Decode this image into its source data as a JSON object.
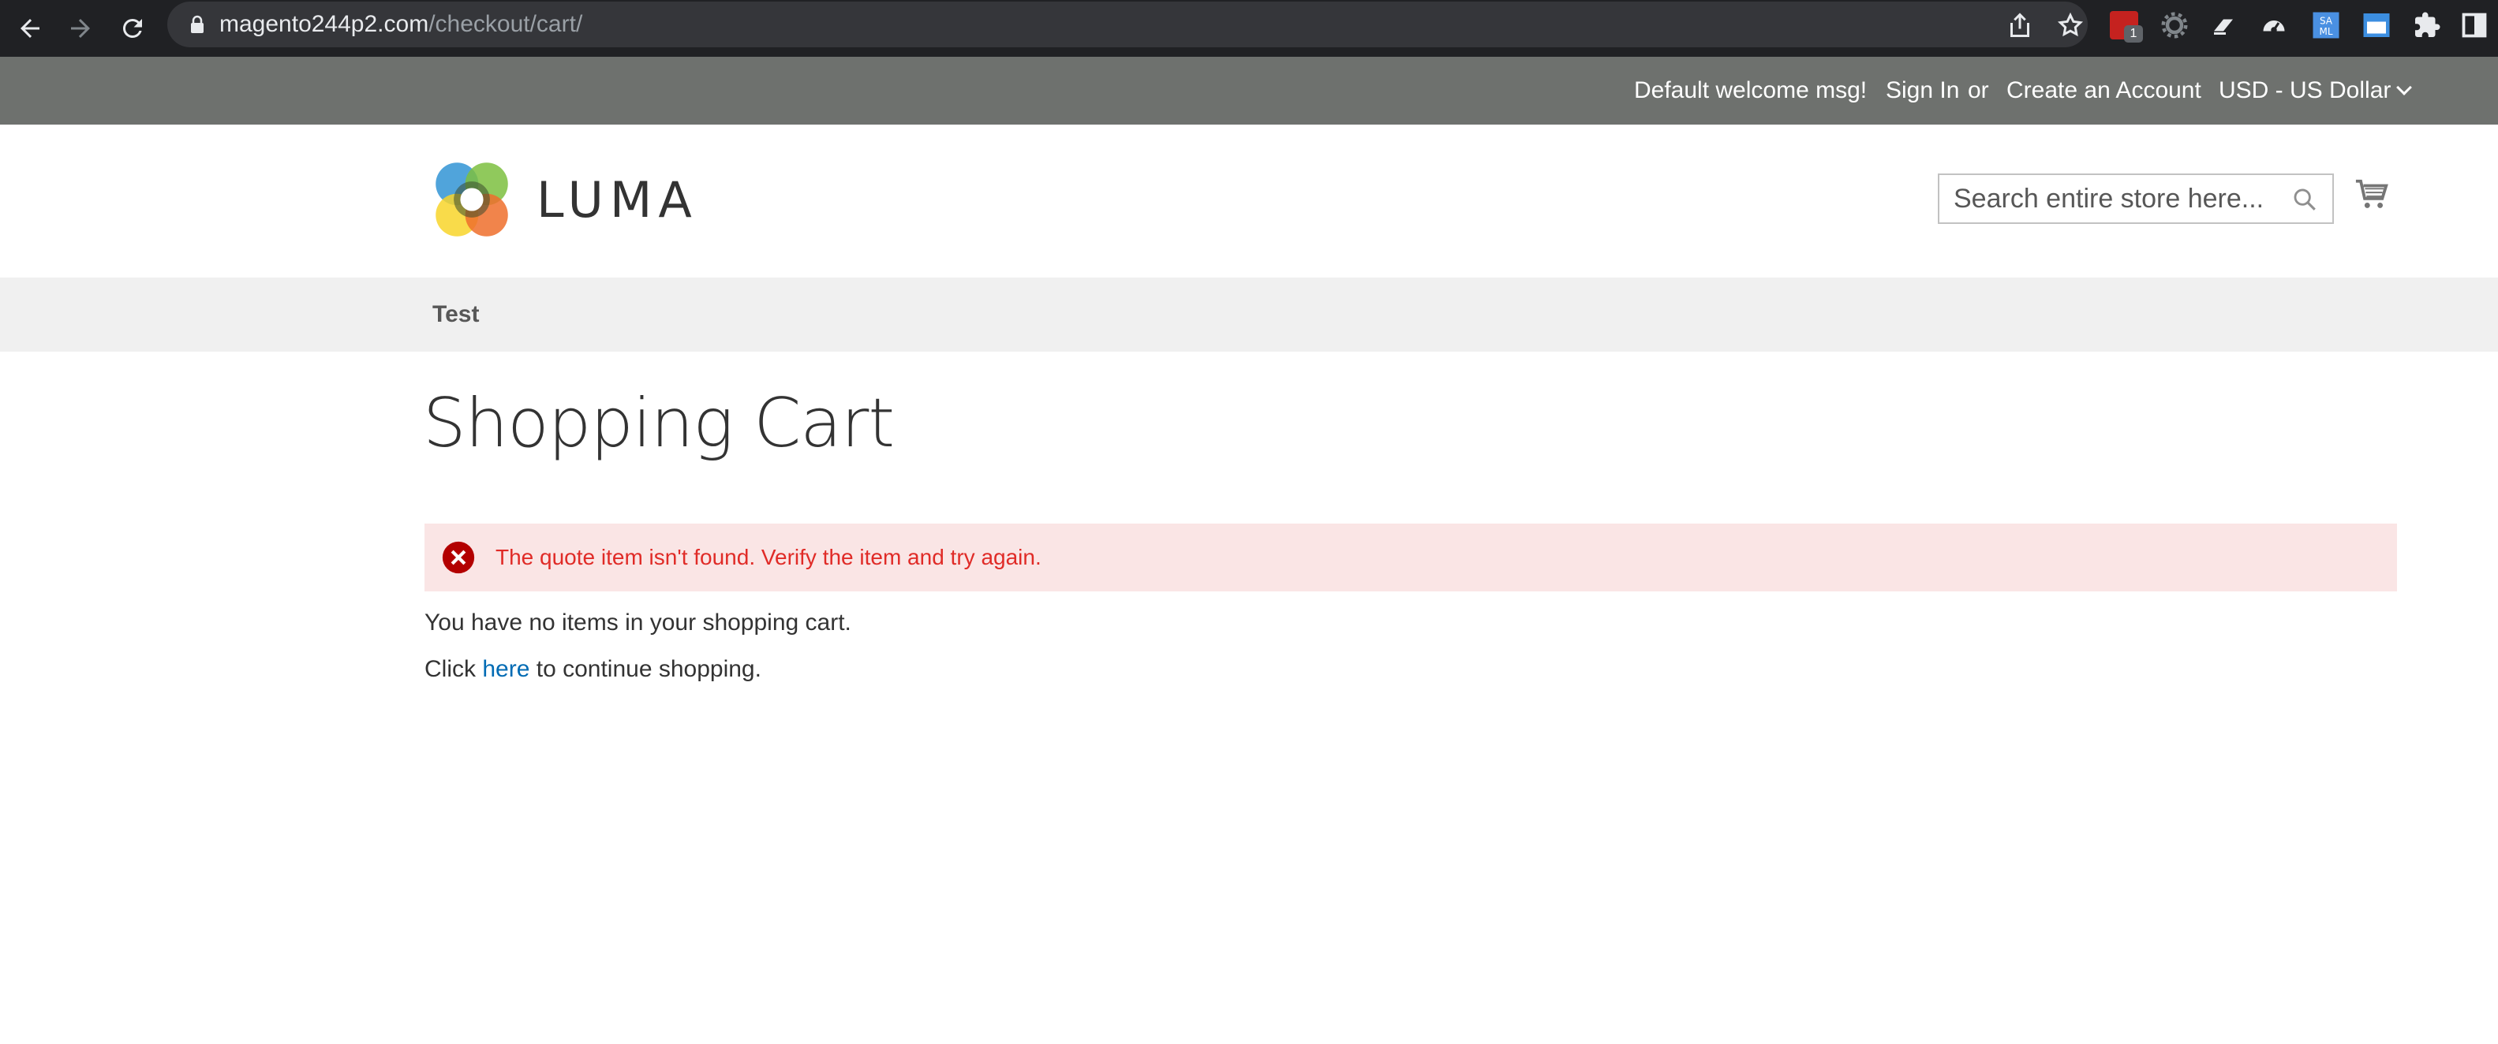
{
  "browser": {
    "url_host": "magento244p2.com",
    "url_path": "/checkout/cart/",
    "extension_badge": "1"
  },
  "panel": {
    "welcome": "Default welcome msg!",
    "sign_in": "Sign In",
    "or": "or",
    "create_account": "Create an Account",
    "currency": "USD - US Dollar"
  },
  "header": {
    "logo_text": "LUMA",
    "search_placeholder": "Search entire store here..."
  },
  "nav": {
    "items": [
      {
        "label": "Test"
      }
    ]
  },
  "main": {
    "title": "Shopping Cart",
    "error_message": "The quote item isn't found. Verify the item and try again.",
    "empty_text": "You have no items in your shopping cart.",
    "continue_prefix": "Click",
    "continue_link": "here",
    "continue_suffix": "to continue shopping."
  },
  "colors": {
    "panel_bg": "#6e716e",
    "nav_bg": "#f0f0f0",
    "error_bg": "#fae5e5",
    "error_text": "#e02b27",
    "link": "#006bb4"
  },
  "icons": {
    "back": "back-arrow-icon",
    "forward": "forward-arrow-icon",
    "reload": "reload-icon",
    "lock": "lock-icon",
    "share": "share-icon",
    "bookmark": "star-icon",
    "search": "search-icon",
    "cart": "cart-icon",
    "error": "error-circle-icon"
  }
}
